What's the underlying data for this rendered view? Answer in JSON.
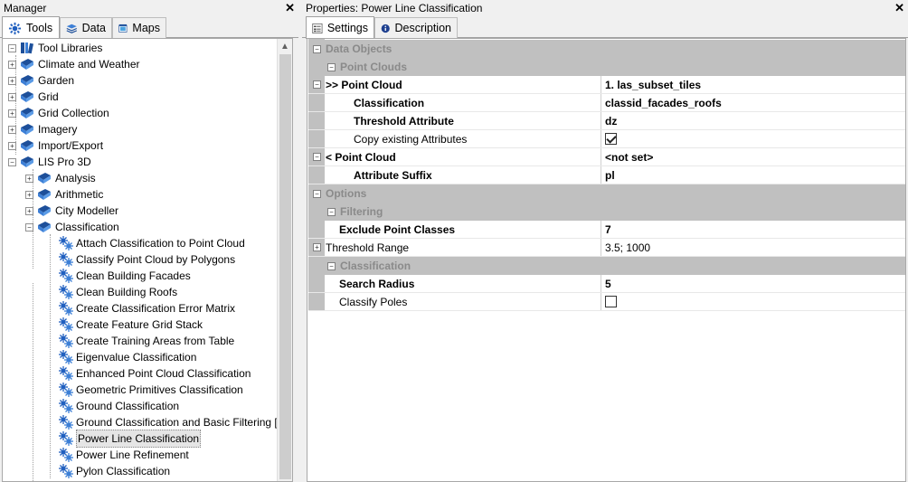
{
  "manager": {
    "title": "Manager",
    "close": "✕",
    "tabs": [
      {
        "label": "Tools",
        "icon": "tools-icon"
      },
      {
        "label": "Data",
        "icon": "data-layers-icon"
      },
      {
        "label": "Maps",
        "icon": "maps-icon"
      }
    ],
    "tree": {
      "root": "Tool Libraries",
      "items": [
        {
          "label": "Climate and Weather",
          "type": "library",
          "expander": "+"
        },
        {
          "label": "Garden",
          "type": "library",
          "expander": "+"
        },
        {
          "label": "Grid",
          "type": "library",
          "expander": "+"
        },
        {
          "label": "Grid Collection",
          "type": "library",
          "expander": "+"
        },
        {
          "label": "Imagery",
          "type": "library",
          "expander": "+"
        },
        {
          "label": "Import/Export",
          "type": "library",
          "expander": "+"
        },
        {
          "label": "LIS Pro 3D",
          "type": "library",
          "expander": "−"
        },
        {
          "label": "Analysis",
          "type": "sublibrary",
          "expander": "+"
        },
        {
          "label": "Arithmetic",
          "type": "sublibrary",
          "expander": "+"
        },
        {
          "label": "City Modeller",
          "type": "sublibrary",
          "expander": "+"
        },
        {
          "label": "Classification",
          "type": "sublibrary",
          "expander": "−"
        },
        {
          "label": "Attach Classification to Point Cloud",
          "type": "tool"
        },
        {
          "label": "Classify Point Cloud by Polygons",
          "type": "tool"
        },
        {
          "label": "Clean Building Facades",
          "type": "tool"
        },
        {
          "label": "Clean Building Roofs",
          "type": "tool"
        },
        {
          "label": "Create Classification Error Matrix",
          "type": "tool"
        },
        {
          "label": "Create Feature Grid Stack",
          "type": "tool"
        },
        {
          "label": "Create Training Areas from Table",
          "type": "tool"
        },
        {
          "label": "Eigenvalue Classification",
          "type": "tool"
        },
        {
          "label": "Enhanced Point Cloud Classification",
          "type": "tool"
        },
        {
          "label": "Geometric Primitives Classification",
          "type": "tool"
        },
        {
          "label": "Ground Classification",
          "type": "tool"
        },
        {
          "label": "Ground Classification and Basic Filtering [",
          "type": "tool"
        },
        {
          "label": "Power Line Classification",
          "type": "tool",
          "selected": true
        },
        {
          "label": "Power Line Refinement",
          "type": "tool"
        },
        {
          "label": "Pylon Classification",
          "type": "tool"
        }
      ]
    }
  },
  "properties": {
    "title": "Properties: Power Line Classification",
    "close": "✕",
    "tabs": [
      {
        "label": "Settings",
        "icon": "settings-icon"
      },
      {
        "label": "Description",
        "icon": "info-icon"
      }
    ],
    "rows": [
      {
        "kind": "cat",
        "level": 0,
        "name": "Data Objects",
        "toggle": "−"
      },
      {
        "kind": "cat",
        "level": 1,
        "name": "Point Clouds",
        "toggle": "−"
      },
      {
        "kind": "prop",
        "level": 1,
        "name": "&gt;&gt; Point Cloud",
        "value": "1. las_subset_tiles",
        "bold": true,
        "toggle": "−",
        "val_bold": true
      },
      {
        "kind": "prop",
        "level": 2,
        "name": "Classification",
        "value": "classid_facades_roofs",
        "bold": true,
        "val_bold": true
      },
      {
        "kind": "prop",
        "level": 2,
        "name": "Threshold Attribute",
        "value": "dz",
        "bold": true,
        "val_bold": true
      },
      {
        "kind": "prop",
        "level": 2,
        "name": "Copy existing Attributes",
        "value": "",
        "checkbox": true,
        "checked": true
      },
      {
        "kind": "prop",
        "level": 1,
        "name": "&lt; Point Cloud",
        "value": "<not set>",
        "bold": true,
        "toggle": "−",
        "val_bold": true
      },
      {
        "kind": "prop",
        "level": 2,
        "name": "Attribute Suffix",
        "value": "pl",
        "bold": true,
        "val_bold": true
      },
      {
        "kind": "cat",
        "level": 0,
        "name": "Options",
        "toggle": "−"
      },
      {
        "kind": "cat",
        "level": 1,
        "name": "Filtering",
        "toggle": "−"
      },
      {
        "kind": "prop",
        "level": 1,
        "name": "Exclude Point Classes",
        "value": "7",
        "bold": true,
        "val_bold": true
      },
      {
        "kind": "prop",
        "level": 1,
        "name": "Threshold Range",
        "value": "3.5; 1000",
        "toggle": "+"
      },
      {
        "kind": "cat",
        "level": 1,
        "name": "Classification",
        "toggle": "−"
      },
      {
        "kind": "prop",
        "level": 1,
        "name": "Search Radius",
        "value": "5",
        "bold": true,
        "val_bold": true
      },
      {
        "kind": "prop",
        "level": 1,
        "name": "Classify Poles",
        "value": "",
        "checkbox": true,
        "checked": false
      }
    ]
  }
}
